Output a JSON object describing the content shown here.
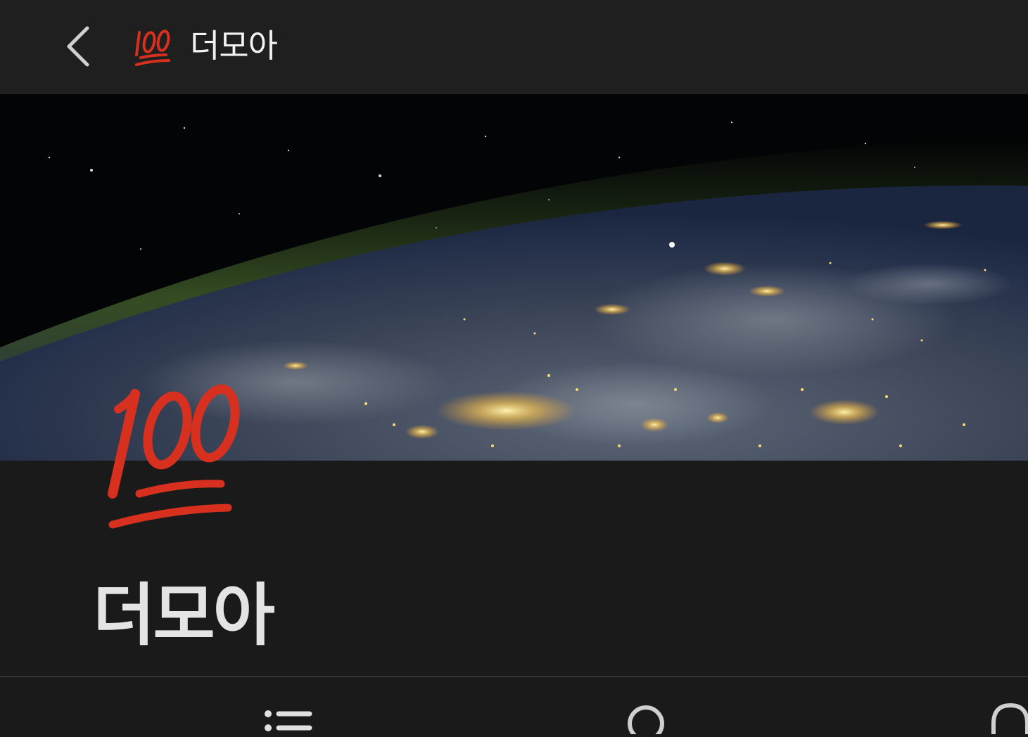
{
  "header": {
    "back_icon": "chevron-left-icon",
    "logo_icon": "hundred-points-emoji",
    "title": "더모아"
  },
  "banner": {
    "image": "earth-at-night-from-space"
  },
  "profile": {
    "logo_icon": "hundred-points-emoji",
    "name": "더모아"
  },
  "bottom_nav": {
    "items": [
      {
        "icon": "list-icon"
      },
      {
        "icon": "search-icon"
      },
      {
        "icon": "bell-icon"
      }
    ]
  },
  "colors": {
    "background": "#1a1a1a",
    "header_background": "#1f1f1f",
    "emoji_red": "#d8301f",
    "title_text": "#e4e4e4",
    "icon_color": "#d0d0d0"
  }
}
